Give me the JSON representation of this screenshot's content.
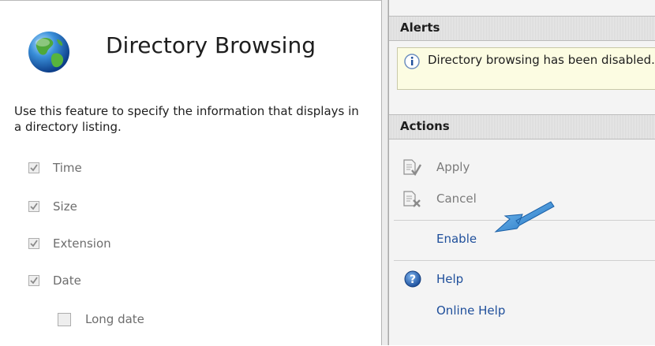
{
  "feature": {
    "title": "Directory Browsing",
    "description": "Use this feature to specify the information that displays in a directory listing.",
    "icon": "globe-icon"
  },
  "options": [
    {
      "label": "Time",
      "checked": true
    },
    {
      "label": "Size",
      "checked": true
    },
    {
      "label": "Extension",
      "checked": true
    },
    {
      "label": "Date",
      "checked": true
    },
    {
      "label": "Long date",
      "checked": false
    }
  ],
  "alerts": {
    "header": "Alerts",
    "message": "Directory browsing has been disabled.",
    "icon": "info-icon"
  },
  "actions": {
    "header": "Actions",
    "apply": "Apply",
    "cancel": "Cancel",
    "enable": "Enable",
    "help": "Help",
    "online_help": "Online Help"
  },
  "colors": {
    "link": "#1f4f9b",
    "disabled": "#7b7b7b",
    "alert_bg": "#fcfce2",
    "arrow": "#2a8ad4"
  }
}
